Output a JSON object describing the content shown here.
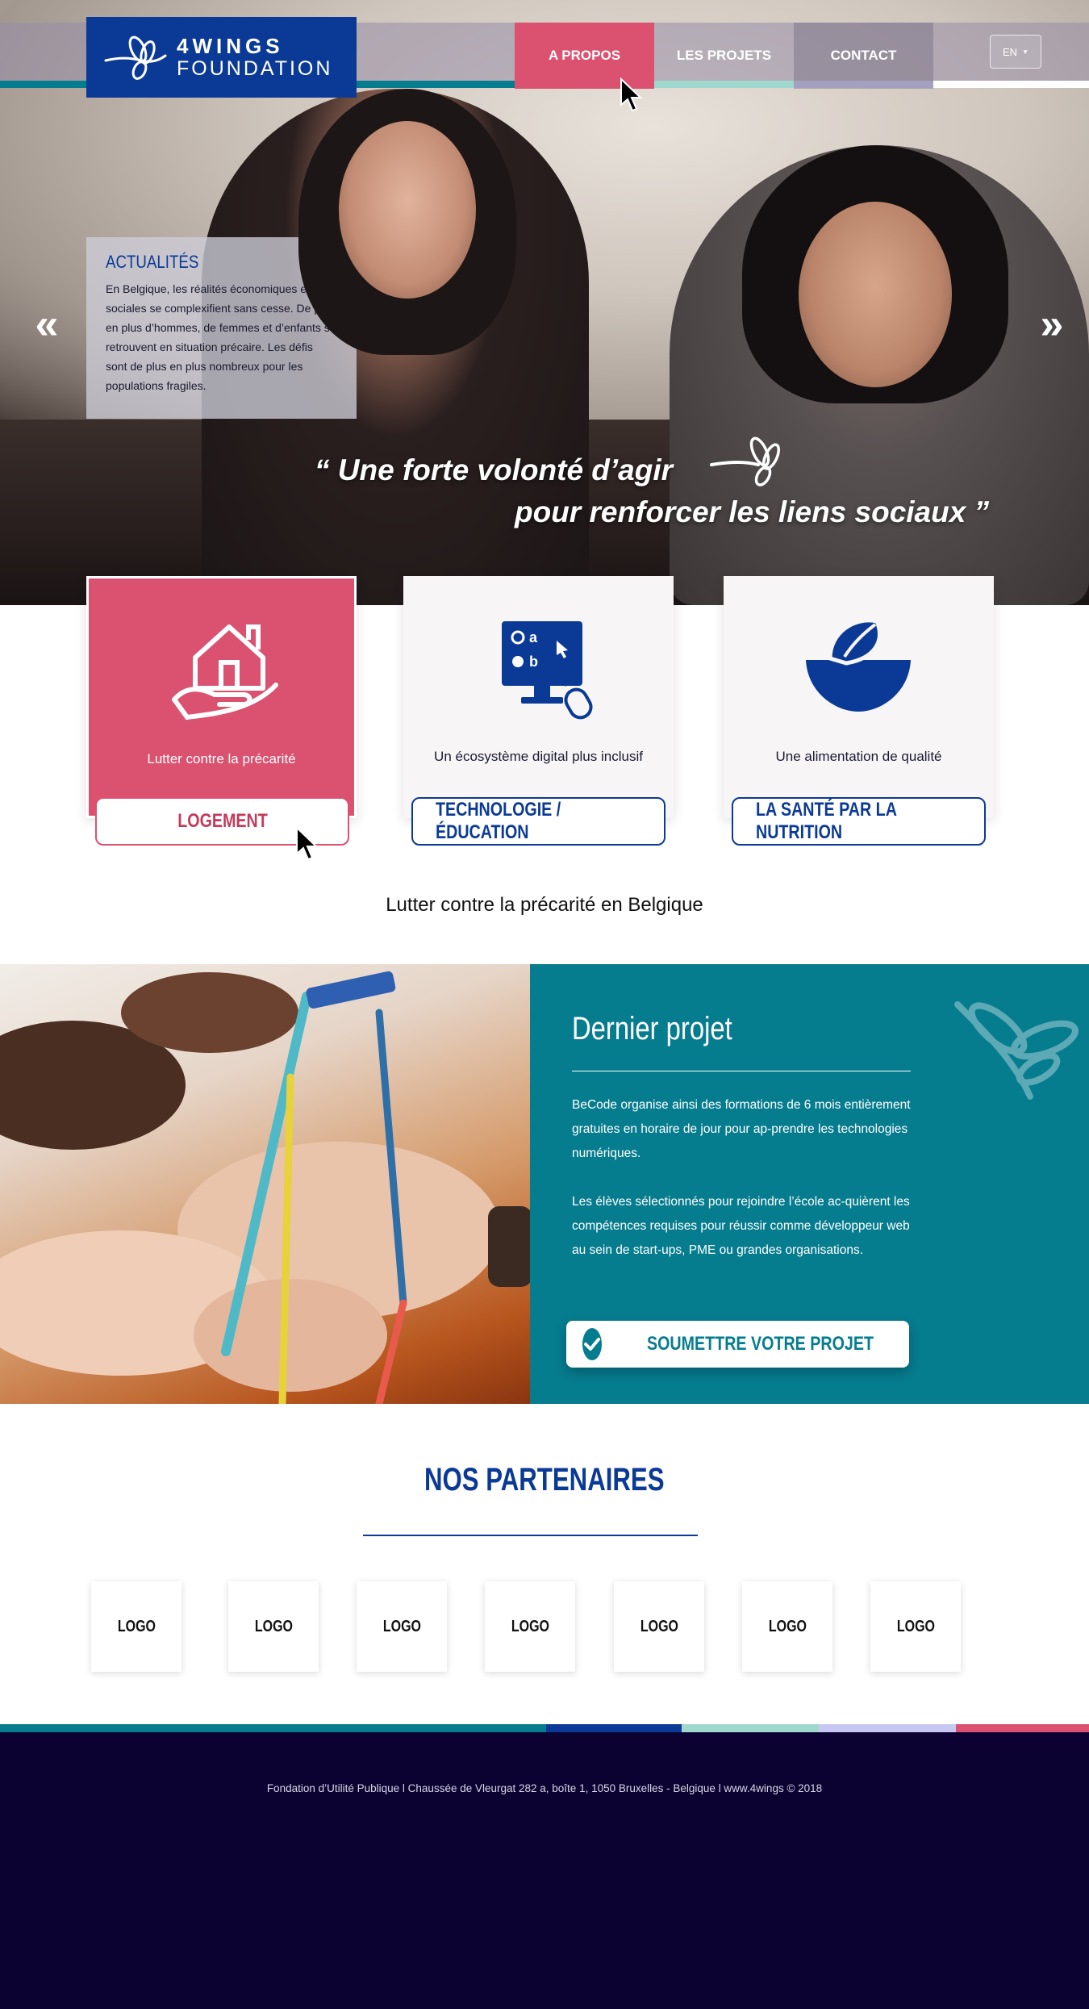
{
  "brand": {
    "name_line1": "4WINGS",
    "name_line2": "FOUNDATION",
    "logo_color": "#0b3a96"
  },
  "nav": {
    "items": [
      {
        "label": "A PROPOS",
        "active": true
      },
      {
        "label": "LES PROJETS",
        "active": false
      },
      {
        "label": "CONTACT",
        "active": false
      }
    ],
    "language": "EN"
  },
  "colors": {
    "pink": "#db5170",
    "blue": "#0b3a96",
    "teal": "#067c8f",
    "mint": "#9fd8cc",
    "lavender": "#c6c8f3",
    "navy": "#0c0232"
  },
  "news": {
    "title": "ACTUALITÉS",
    "body": "En Belgique, les réalités économiques et sociales se complexifient sans cesse. De plus en plus d’hommes, de femmes et d’enfants se retrouvent en situation précaire. Les défis sont de plus en plus nombreux pour les populations fragiles."
  },
  "slider": {
    "prev_icon": "chevron-double-left-icon",
    "next_icon": "chevron-double-right-icon",
    "prev_glyph": "«",
    "next_glyph": "»"
  },
  "hero_quote": {
    "line1": "“ Une forte volonté d’agir",
    "line2": "pour renforcer les liens sociaux ”"
  },
  "categories": [
    {
      "icon": "house-hand-icon",
      "text": "Lutter contre la précarité",
      "button": "LOGEMENT",
      "active": true
    },
    {
      "icon": "computer-education-icon",
      "text": "Un écosystème digital plus inclusif",
      "button": "TECHNOLOGIE / ÉDUCATION",
      "active": false
    },
    {
      "icon": "leaf-bowl-icon",
      "text": "Une alimentation de qualité",
      "button": "LA SANTÉ PAR LA NUTRITION",
      "active": false
    }
  ],
  "tagline": "Lutter contre la précarité en Belgique",
  "project": {
    "title": "Dernier projet",
    "paragraph1": "BeCode organise ainsi des formations de 6 mois entièrement gratuites en horaire de jour pour ap-prendre les technologies numériques.",
    "paragraph2": "Les élèves sélectionnés pour rejoindre l’école ac-quièrent les compétences requises pour réussir comme développeur web au sein de start-ups, PME ou grandes organisations.",
    "submit_label": "SOUMETTRE VOTRE PROJET"
  },
  "partners": {
    "title": "NOS PARTENAIRES",
    "logos": [
      "LOGO",
      "LOGO",
      "LOGO",
      "LOGO",
      "LOGO",
      "LOGO",
      "LOGO"
    ]
  },
  "footer": {
    "text": "Fondation d’Utilité Publique  l Chaussée de Vleurgat 282 a, boîte 1, 1050 Bruxelles - Belgique l www.4wings © 2018"
  }
}
